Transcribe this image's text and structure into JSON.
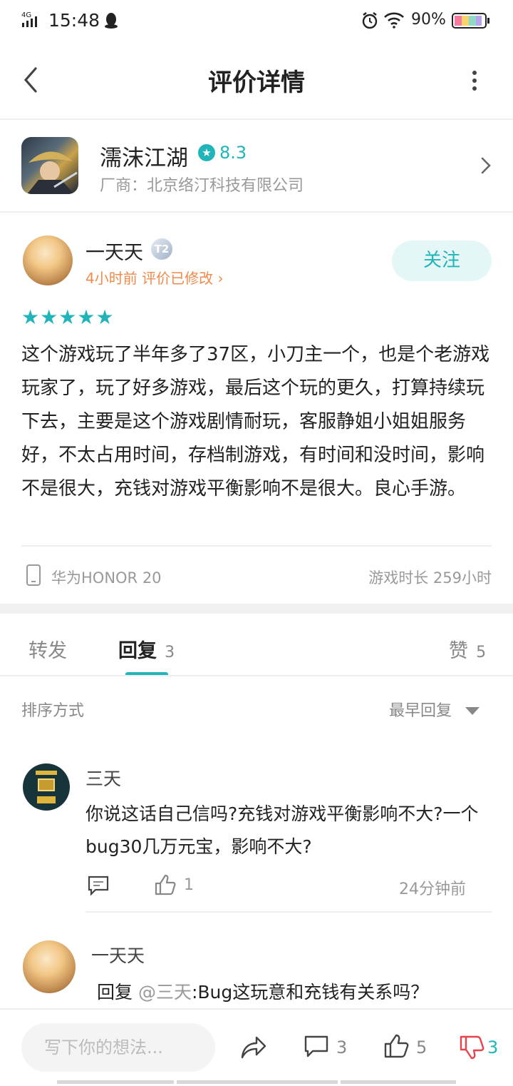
{
  "status_bar": {
    "network": "4G",
    "time": "15:48",
    "battery": "90%"
  },
  "header": {
    "title": "评价详情"
  },
  "app": {
    "name": "濡沫江湖",
    "rating": "8.3",
    "vendor": "厂商：北京络汀科技有限公司"
  },
  "review": {
    "user": "一天天",
    "badge": "T2",
    "time_info": "4小时前 评价已修改",
    "follow_label": "关注",
    "stars": 5,
    "text": "这个游戏玩了半年多了37区，小刀主一个，也是个老游戏玩家了，玩了好多游戏，最后这个玩的更久，打算持续玩下去，主要是这个游戏剧情耐玩，客服静姐小姐姐服务好，不太占用时间，存档制游戏，有时间和没时间，影响不是很大，充钱对游戏平衡影响不是很大。良心手游。",
    "device": "华为HONOR 20",
    "playtime": "游戏时长 259小时"
  },
  "tabs": {
    "forward": "转发",
    "reply": "回复",
    "reply_count": "3",
    "like": "赞",
    "like_count": "5"
  },
  "sort": {
    "label": "排序方式",
    "value": "最早回复"
  },
  "comments": [
    {
      "user": "三天",
      "text": "你说这话自己信吗?充钱对游戏平衡影响不大?一个bug30几万元宝，影响不大?",
      "likes": "1",
      "time": "24分钟前"
    },
    {
      "user": "一天天",
      "reply_prefix": "回复 ",
      "mention": "@三天",
      "text": ":Bug这玩意和充钱有关系吗？"
    }
  ],
  "bottom": {
    "placeholder": "写下你的想法...",
    "comment_count": "3",
    "like_count": "5",
    "dislike_count": "3"
  },
  "colors": {
    "accent": "#21b4b8",
    "dislike": "#e8434d",
    "time_info": "#f08a4b"
  }
}
